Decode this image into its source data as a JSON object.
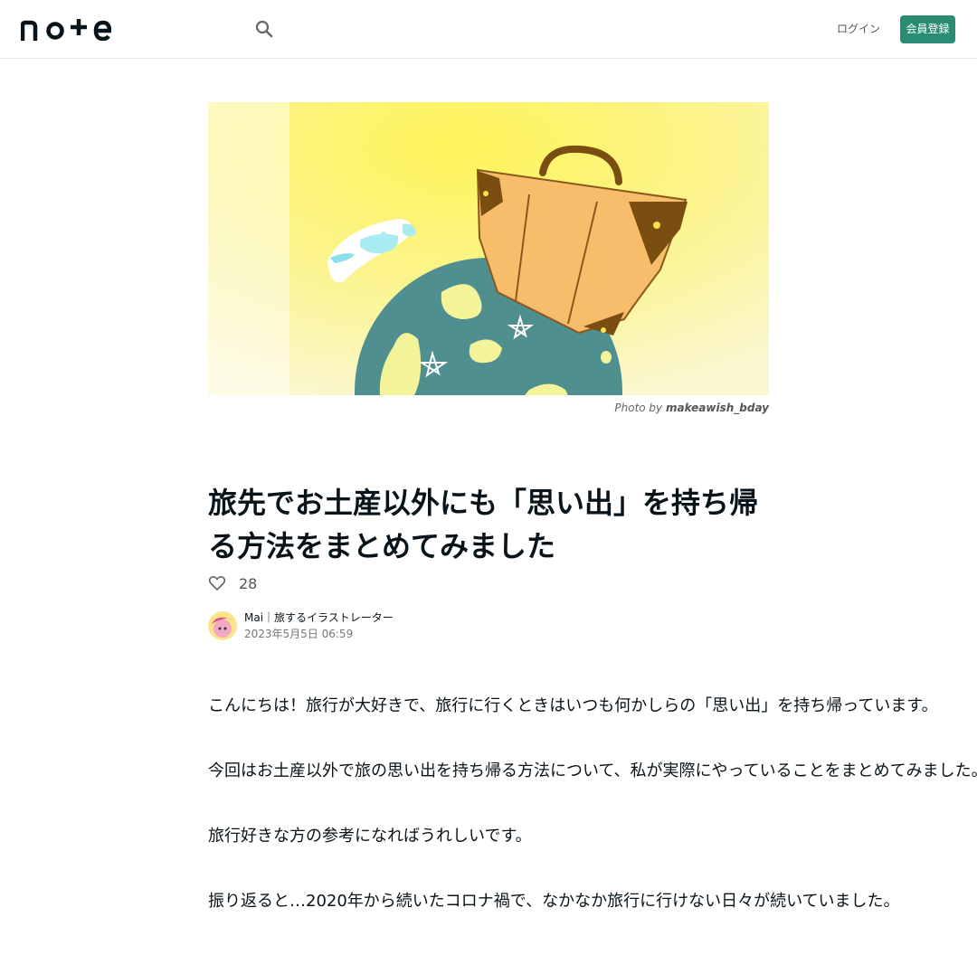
{
  "header": {
    "logo_text": "note",
    "login_label": "ログイン",
    "signup_label": "会員登録"
  },
  "hero": {
    "credit_prefix": "Photo by",
    "credit_name": "makeawish_bday"
  },
  "article": {
    "title": "旅先でお土産以外にも「思い出」を持ち帰る方法をまとめてみました",
    "likes": "28",
    "author_name": "Mai｜旅するイラストレーター",
    "date": "2023年5月5日 06:59",
    "paragraphs": [
      "こんにちは！旅行が大好きで、旅行に行くときはいつも何かしらの「思い出」を持ち帰っています。",
      "今回はお土産以外で旅の思い出を持ち帰る方法について、私が実際にやっていることをまとめてみました。",
      "旅行好きな方の参考になればうれしいです。",
      "振り返ると…2020年から続いたコロナ禍で、なかなか旅行に行けない日々が続いていました。"
    ]
  },
  "colors": {
    "accent": "#2b8c74",
    "text": "#08131a"
  }
}
